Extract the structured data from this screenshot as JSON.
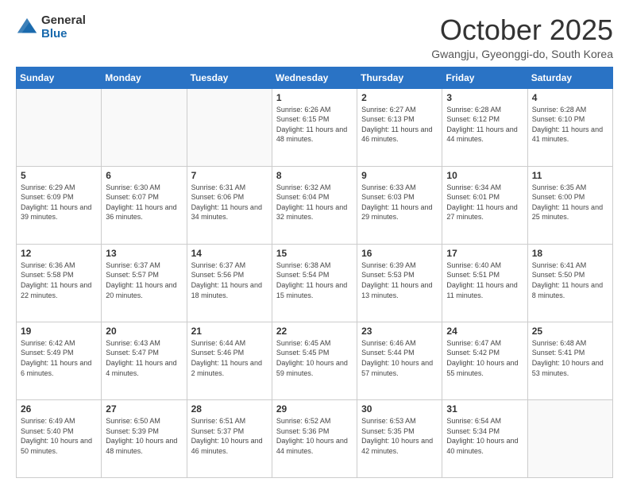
{
  "logo": {
    "general": "General",
    "blue": "Blue"
  },
  "header": {
    "month": "October 2025",
    "location": "Gwangju, Gyeonggi-do, South Korea"
  },
  "days_of_week": [
    "Sunday",
    "Monday",
    "Tuesday",
    "Wednesday",
    "Thursday",
    "Friday",
    "Saturday"
  ],
  "weeks": [
    [
      {
        "day": "",
        "info": ""
      },
      {
        "day": "",
        "info": ""
      },
      {
        "day": "",
        "info": ""
      },
      {
        "day": "1",
        "info": "Sunrise: 6:26 AM\nSunset: 6:15 PM\nDaylight: 11 hours\nand 48 minutes."
      },
      {
        "day": "2",
        "info": "Sunrise: 6:27 AM\nSunset: 6:13 PM\nDaylight: 11 hours\nand 46 minutes."
      },
      {
        "day": "3",
        "info": "Sunrise: 6:28 AM\nSunset: 6:12 PM\nDaylight: 11 hours\nand 44 minutes."
      },
      {
        "day": "4",
        "info": "Sunrise: 6:28 AM\nSunset: 6:10 PM\nDaylight: 11 hours\nand 41 minutes."
      }
    ],
    [
      {
        "day": "5",
        "info": "Sunrise: 6:29 AM\nSunset: 6:09 PM\nDaylight: 11 hours\nand 39 minutes."
      },
      {
        "day": "6",
        "info": "Sunrise: 6:30 AM\nSunset: 6:07 PM\nDaylight: 11 hours\nand 36 minutes."
      },
      {
        "day": "7",
        "info": "Sunrise: 6:31 AM\nSunset: 6:06 PM\nDaylight: 11 hours\nand 34 minutes."
      },
      {
        "day": "8",
        "info": "Sunrise: 6:32 AM\nSunset: 6:04 PM\nDaylight: 11 hours\nand 32 minutes."
      },
      {
        "day": "9",
        "info": "Sunrise: 6:33 AM\nSunset: 6:03 PM\nDaylight: 11 hours\nand 29 minutes."
      },
      {
        "day": "10",
        "info": "Sunrise: 6:34 AM\nSunset: 6:01 PM\nDaylight: 11 hours\nand 27 minutes."
      },
      {
        "day": "11",
        "info": "Sunrise: 6:35 AM\nSunset: 6:00 PM\nDaylight: 11 hours\nand 25 minutes."
      }
    ],
    [
      {
        "day": "12",
        "info": "Sunrise: 6:36 AM\nSunset: 5:58 PM\nDaylight: 11 hours\nand 22 minutes."
      },
      {
        "day": "13",
        "info": "Sunrise: 6:37 AM\nSunset: 5:57 PM\nDaylight: 11 hours\nand 20 minutes."
      },
      {
        "day": "14",
        "info": "Sunrise: 6:37 AM\nSunset: 5:56 PM\nDaylight: 11 hours\nand 18 minutes."
      },
      {
        "day": "15",
        "info": "Sunrise: 6:38 AM\nSunset: 5:54 PM\nDaylight: 11 hours\nand 15 minutes."
      },
      {
        "day": "16",
        "info": "Sunrise: 6:39 AM\nSunset: 5:53 PM\nDaylight: 11 hours\nand 13 minutes."
      },
      {
        "day": "17",
        "info": "Sunrise: 6:40 AM\nSunset: 5:51 PM\nDaylight: 11 hours\nand 11 minutes."
      },
      {
        "day": "18",
        "info": "Sunrise: 6:41 AM\nSunset: 5:50 PM\nDaylight: 11 hours\nand 8 minutes."
      }
    ],
    [
      {
        "day": "19",
        "info": "Sunrise: 6:42 AM\nSunset: 5:49 PM\nDaylight: 11 hours\nand 6 minutes."
      },
      {
        "day": "20",
        "info": "Sunrise: 6:43 AM\nSunset: 5:47 PM\nDaylight: 11 hours\nand 4 minutes."
      },
      {
        "day": "21",
        "info": "Sunrise: 6:44 AM\nSunset: 5:46 PM\nDaylight: 11 hours\nand 2 minutes."
      },
      {
        "day": "22",
        "info": "Sunrise: 6:45 AM\nSunset: 5:45 PM\nDaylight: 10 hours\nand 59 minutes."
      },
      {
        "day": "23",
        "info": "Sunrise: 6:46 AM\nSunset: 5:44 PM\nDaylight: 10 hours\nand 57 minutes."
      },
      {
        "day": "24",
        "info": "Sunrise: 6:47 AM\nSunset: 5:42 PM\nDaylight: 10 hours\nand 55 minutes."
      },
      {
        "day": "25",
        "info": "Sunrise: 6:48 AM\nSunset: 5:41 PM\nDaylight: 10 hours\nand 53 minutes."
      }
    ],
    [
      {
        "day": "26",
        "info": "Sunrise: 6:49 AM\nSunset: 5:40 PM\nDaylight: 10 hours\nand 50 minutes."
      },
      {
        "day": "27",
        "info": "Sunrise: 6:50 AM\nSunset: 5:39 PM\nDaylight: 10 hours\nand 48 minutes."
      },
      {
        "day": "28",
        "info": "Sunrise: 6:51 AM\nSunset: 5:37 PM\nDaylight: 10 hours\nand 46 minutes."
      },
      {
        "day": "29",
        "info": "Sunrise: 6:52 AM\nSunset: 5:36 PM\nDaylight: 10 hours\nand 44 minutes."
      },
      {
        "day": "30",
        "info": "Sunrise: 6:53 AM\nSunset: 5:35 PM\nDaylight: 10 hours\nand 42 minutes."
      },
      {
        "day": "31",
        "info": "Sunrise: 6:54 AM\nSunset: 5:34 PM\nDaylight: 10 hours\nand 40 minutes."
      },
      {
        "day": "",
        "info": ""
      }
    ]
  ]
}
